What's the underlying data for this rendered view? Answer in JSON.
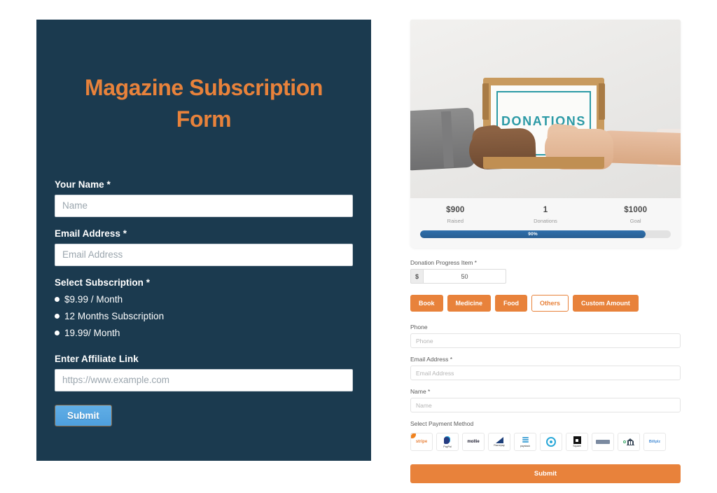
{
  "colors": {
    "navy": "#1b3a4f",
    "orange": "#e8823b",
    "teal": "#2c9aa6",
    "progress_blue": "#2f6fab",
    "submit_blue": "#4e9fdd"
  },
  "subscription_form": {
    "title": "Magazine Subscription Form",
    "name_label": "Your Name *",
    "name_placeholder": "Name",
    "name_value": "",
    "email_label": "Email Address *",
    "email_placeholder": "Email Address",
    "email_value": "",
    "subscription_label": "Select Subscription *",
    "options": [
      {
        "label": "$9.99 / Month"
      },
      {
        "label": "12 Months Subscription"
      },
      {
        "label": "19.99/ Month"
      }
    ],
    "affiliate_label": "Enter Affiliate Link",
    "affiliate_placeholder": "https://www.example.com",
    "affiliate_value": "",
    "submit_label": "Submit"
  },
  "donation_form": {
    "photo": {
      "caption": "DONATIONS",
      "alt": "two hands exchanging a cardboard donations box"
    },
    "stats": [
      {
        "value": "$900",
        "label": "Raised"
      },
      {
        "value": "1",
        "label": "Donations"
      },
      {
        "value": "$1000",
        "label": "Goal"
      }
    ],
    "progress": {
      "percent_text": "90%",
      "percent": 90
    },
    "amount_label": "Donation Progress Item *",
    "currency_symbol": "$",
    "amount_value": "50",
    "chips": [
      {
        "label": "Book",
        "selected": false
      },
      {
        "label": "Medicine",
        "selected": false
      },
      {
        "label": "Food",
        "selected": false
      },
      {
        "label": "Others",
        "selected": true
      },
      {
        "label": "Custom Amount",
        "selected": false
      }
    ],
    "phone_label": "Phone",
    "phone_placeholder": "Phone",
    "phone_value": "",
    "email_label": "Email Address *",
    "email_placeholder": "Email Address",
    "email_value": "",
    "name_label": "Name *",
    "name_placeholder": "Name",
    "name_value": "",
    "payment_label": "Select Payment Method",
    "payment_methods": [
      {
        "name": "stripe",
        "text": "stripe",
        "selected": true
      },
      {
        "name": "paypal",
        "text": "PayPal",
        "selected": false
      },
      {
        "name": "mollie",
        "text": "mollie",
        "selected": false
      },
      {
        "name": "razorpay",
        "text": "Razorpay",
        "selected": false
      },
      {
        "name": "paystack",
        "text": "paystack",
        "selected": false
      },
      {
        "name": "payu",
        "text": "PayU",
        "selected": false
      },
      {
        "name": "square",
        "text": "Square",
        "selected": false
      },
      {
        "name": "card",
        "text": "Card",
        "selected": false
      },
      {
        "name": "bank-transfer",
        "text": "Bank",
        "selected": false
      },
      {
        "name": "billplz",
        "text": "Billplz",
        "selected": false
      }
    ],
    "submit_label": "Submit"
  }
}
